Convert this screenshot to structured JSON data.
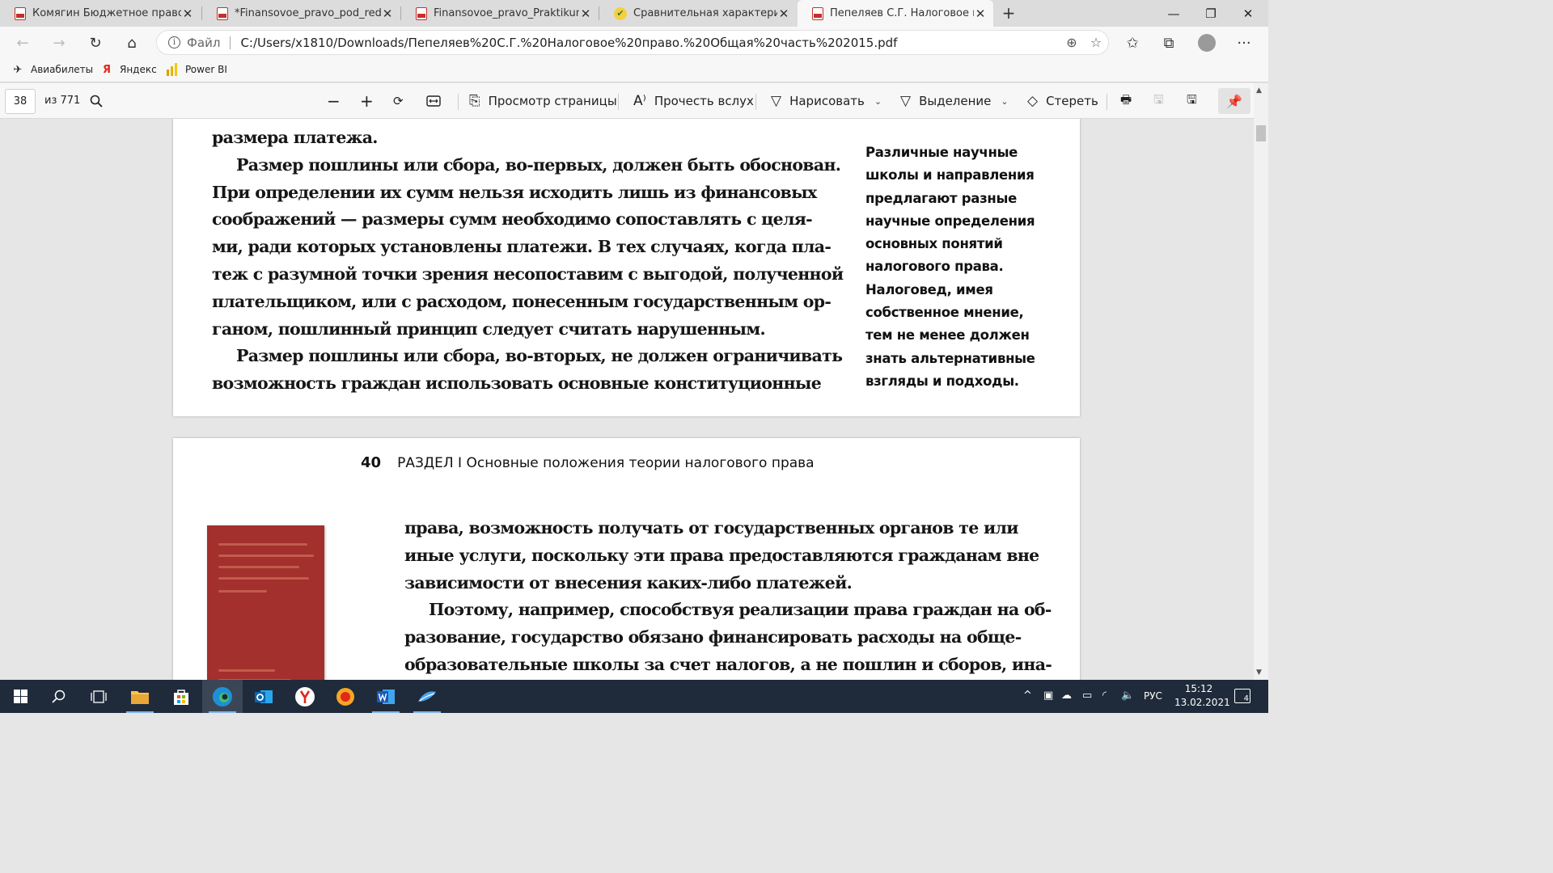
{
  "tabs": [
    {
      "title": "Комягин Бюджетное право в С",
      "icon": "pdf-icon"
    },
    {
      "title": "*Finansovoe_pravo_pod_red_Khi",
      "icon": "pdf-icon"
    },
    {
      "title": "Finansovoe_pravo_Praktikum_ras",
      "icon": "pdf-icon"
    },
    {
      "title": "Сравнительная характеристика",
      "icon": "checkmark-icon"
    },
    {
      "title": "Пепеляев С.Г. Налоговое право",
      "icon": "pdf-icon",
      "active": true
    }
  ],
  "address": {
    "scheme_label": "Файл",
    "url": "C:/Users/x1810/Downloads/Пепеляев%20С.Г.%20Налоговое%20право.%20Общая%20часть%202015.pdf"
  },
  "favorites": [
    {
      "label": "Авиабилеты",
      "icon": "airplane-icon"
    },
    {
      "label": "Яндекс",
      "icon": "yandex-icon"
    },
    {
      "label": "Power BI",
      "icon": "powerbi-icon"
    }
  ],
  "pdf_toolbar": {
    "page_current": "38",
    "page_total": "из 771",
    "view_label": "Просмотр страницы",
    "read_aloud_label": "Прочесть вслух",
    "draw_label": "Нарисовать",
    "highlight_label": "Выделение",
    "erase_label": "Стереть"
  },
  "page1": {
    "body_lines": [
      "размера платежа.",
      "Размер пошлины или сбора, во-первых, должен быть обоснован.",
      "При определении их сумм нельзя исходить лишь из финансовых",
      "соображений — размеры сумм необходимо сопоставлять с целя-",
      "ми, ради которых установлены платежи. В тех случаях, когда пла-",
      "теж с разумной точки зрения несопоставим с выгодой, полученной",
      "плательщиком, или с расходом, понесенным государственным ор-",
      "ганом, пошлинный принцип следует считать нарушенным.",
      "Размер пошлины или сбора, во-вторых, не должен ограничивать",
      "возможность граждан использовать основные конституционные"
    ],
    "sidenote_lines": [
      "Различные научные",
      "школы и направления",
      "предлагают разные",
      "научные определения",
      "основных понятий",
      "налогового права.",
      "Налоговед, имея",
      "собственное мнение,",
      "тем не менее должен",
      "знать альтернативные",
      "взгляды и подходы."
    ]
  },
  "page2": {
    "page_number": "40",
    "running_head": "РАЗДЕЛ I  Основные положения теории налогового права",
    "body_lines": [
      "права, возможность получать от государственных органов те или",
      "иные услуги, поскольку эти права предоставляются гражданам вне",
      "зависимости от внесения каких-либо платежей.",
      "Поэтому, например, способствуя реализации права граждан на об-",
      "разование, государство обязано финансировать расходы на обще-",
      "образовательные школы за счет налогов, а не пошлин и сборов, ина-"
    ]
  },
  "taskbar": {
    "language": "РУС",
    "time": "15:12",
    "date": "13.02.2021",
    "notification_count": "4"
  },
  "colors": {
    "taskbar": "#1f2b3a",
    "pdf_icon": "#c4302b",
    "page_bg": "#ffffff",
    "viewer_bg": "#e6e6e6"
  }
}
